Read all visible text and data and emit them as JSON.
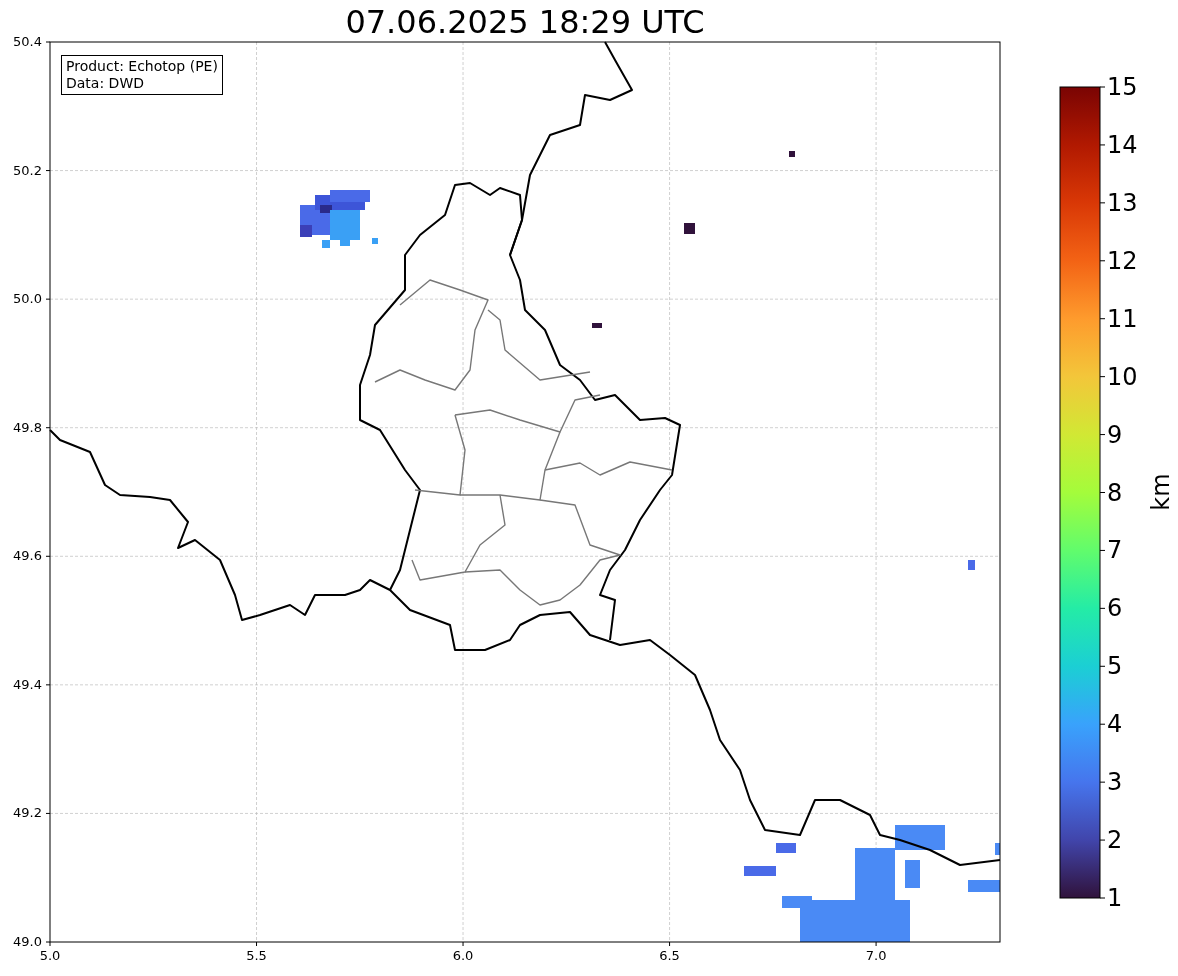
{
  "title": "07.06.2025 18:29 UTC",
  "info_box": [
    "Product: Echotop (PE)",
    "Data: DWD"
  ],
  "map": {
    "x_ticks": [
      "5.0",
      "5.5",
      "6.0",
      "6.5",
      "7.0"
    ],
    "y_ticks": [
      "50.4",
      "50.2",
      "50.0",
      "49.8",
      "49.6",
      "49.4",
      "49.2",
      "49.0"
    ]
  },
  "colorbar": {
    "label": "km",
    "ticks": [
      "15",
      "14",
      "13",
      "12",
      "11",
      "10",
      "9",
      "8",
      "7",
      "6",
      "5",
      "4",
      "3",
      "2",
      "1"
    ]
  }
}
